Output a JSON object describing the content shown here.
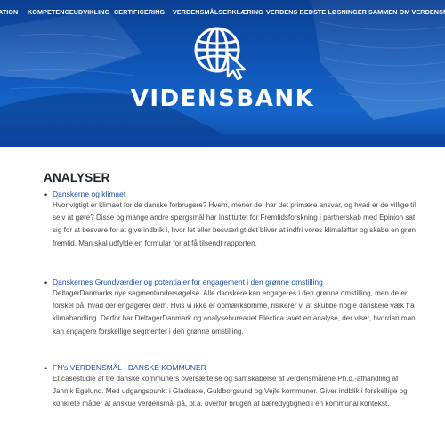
{
  "nav": {
    "items": [
      "ATION",
      "KOMPETENCEUDVIKLING",
      "CERTIFICERING",
      "VERDENSMÅLSERKLÆRING",
      "VERDENS BEDSTE LØSNINGER",
      "SAMMEN OM VERDENSMÅ"
    ]
  },
  "hero": {
    "title": "VIDENSBANK",
    "icon": "globe-cursor-icon"
  },
  "main": {
    "heading": "ANALYSER",
    "entries": [
      {
        "link": "Danskerne og klimaet",
        "text": "Hvor vigtigt er klimaet for de danske forbrugere? Hvem, mener de, har det primære ansvar, og hvad er de villige til selv at gøre? Disse og mange andre spørgsmål har Instituttet for Fremtidsforskning i partnerskab med Epinion sat sig for at besvare for at give indblik i, hvor let eller besværligt det bliver at indfri vores klimaløfter og skabe en grøn fremtid. Man skal udfylde en formular for at få tilsendt rapporten."
      },
      {
        "link": "Danskernes Grundværdier og potentialer for engagement i den grønne omstilling",
        "text": "DeltagerDanmarks nye segmentundersøgelse. Alle danskere kan engageres i den grønne omstilling, men de er forskel på, hvad der engagerer dem. Hvis vi ikke er opmærksomme, risikerer vi at skubbe nogle danskere væk fra klimahandling. Derfor har DeltagerDanmark og analysebureauet Electica lavet en analyse, der viser, hvordan man kan engagere forskellige segmenter i den grønne omstilling."
      },
      {
        "link": "FN's VERDENSMÅL I DANSKE KOMMUNER",
        "text": "Et casestudie af tre danske kommuners oversættelse og samskabelse af verdensmålene Ph.d.-afhandling af Jannik Egelund. Med udgangspunkt i Gladsaxe, Guldborgsund og Vejle kommuner. Giver indblik i forskellige og konkrete måder at anskue verdensmål på, bl.a. overfor brugen af bæredygtighed i en kommunal kontekst."
      }
    ]
  },
  "colors": {
    "hero_blue": "#0f56b8",
    "link_blue": "#1f4fa3",
    "heading": "#1d2430"
  }
}
